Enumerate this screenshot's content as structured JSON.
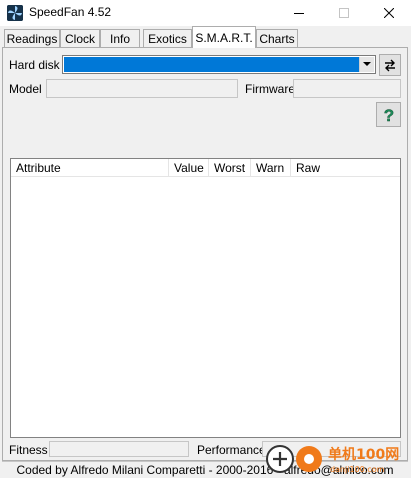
{
  "window": {
    "title": "SpeedFan 4.52"
  },
  "tabs": [
    {
      "label": "Readings"
    },
    {
      "label": "Clock"
    },
    {
      "label": "Info"
    },
    {
      "label": "Exotics"
    },
    {
      "label": "S.M.A.R.T."
    },
    {
      "label": "Charts"
    }
  ],
  "active_tab": "S.M.A.R.T.",
  "smart": {
    "hard_disk_label": "Hard disk",
    "hard_disk_value": "",
    "model_label": "Model",
    "model_value": "",
    "firmware_label": "Firmware",
    "firmware_value": "",
    "help_glyph": "?",
    "table_columns": [
      "Attribute",
      "Value",
      "Worst",
      "Warn",
      "Raw"
    ],
    "table_rows": [],
    "fitness_label": "Fitness",
    "performance_label": "Performance"
  },
  "status_bar": {
    "text": "Coded by Alfredo Milani Comparetti - 2000-2016 - alfredo@almico.com"
  },
  "watermark": {
    "text": "单机100网",
    "sub": "danji100.com"
  },
  "colors": {
    "selection": "#0078d7",
    "help_icon": "#1e8c5a",
    "window_bg": "#f0f0f0"
  }
}
